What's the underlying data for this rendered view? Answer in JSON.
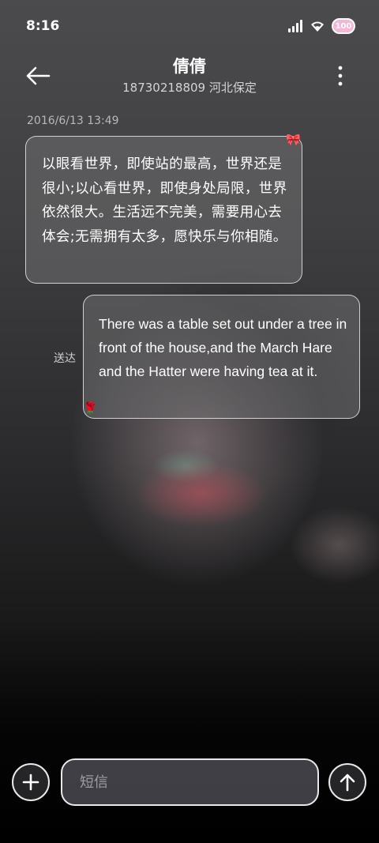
{
  "status_bar": {
    "time": "8:16",
    "battery_label": "100",
    "icons": [
      "signal-icon",
      "wifi-icon",
      "battery-icon"
    ]
  },
  "header": {
    "contact_name": "倩倩",
    "contact_number_location": "18730218809 河北保定",
    "back_icon": "back-arrow-icon",
    "more_icon": "more-vertical-icon"
  },
  "conversation": {
    "timestamp": "2016/6/13 13:49",
    "messages": [
      {
        "direction": "incoming",
        "text": "以眼看世界，即使站的最高，世界还是很小;以心看世界，即使身处局限，世界依然很大。生活远不完美，需要用心去体会;无需拥有太多，愿快乐与你相随。",
        "decoration_icon": "bow-icon"
      },
      {
        "direction": "outgoing",
        "text": "There was a table set out under a tree in front of the house,and the March Hare and the Hatter were having tea at it.",
        "status": "送达",
        "decoration_icon": "rose-icon"
      }
    ]
  },
  "composer": {
    "placeholder": "短信",
    "value": "",
    "add_icon": "plus-icon",
    "send_icon": "send-arrow-icon"
  },
  "colors": {
    "bubble_border": "#e6e6e8",
    "battery_pink": "#f6b6d8"
  }
}
